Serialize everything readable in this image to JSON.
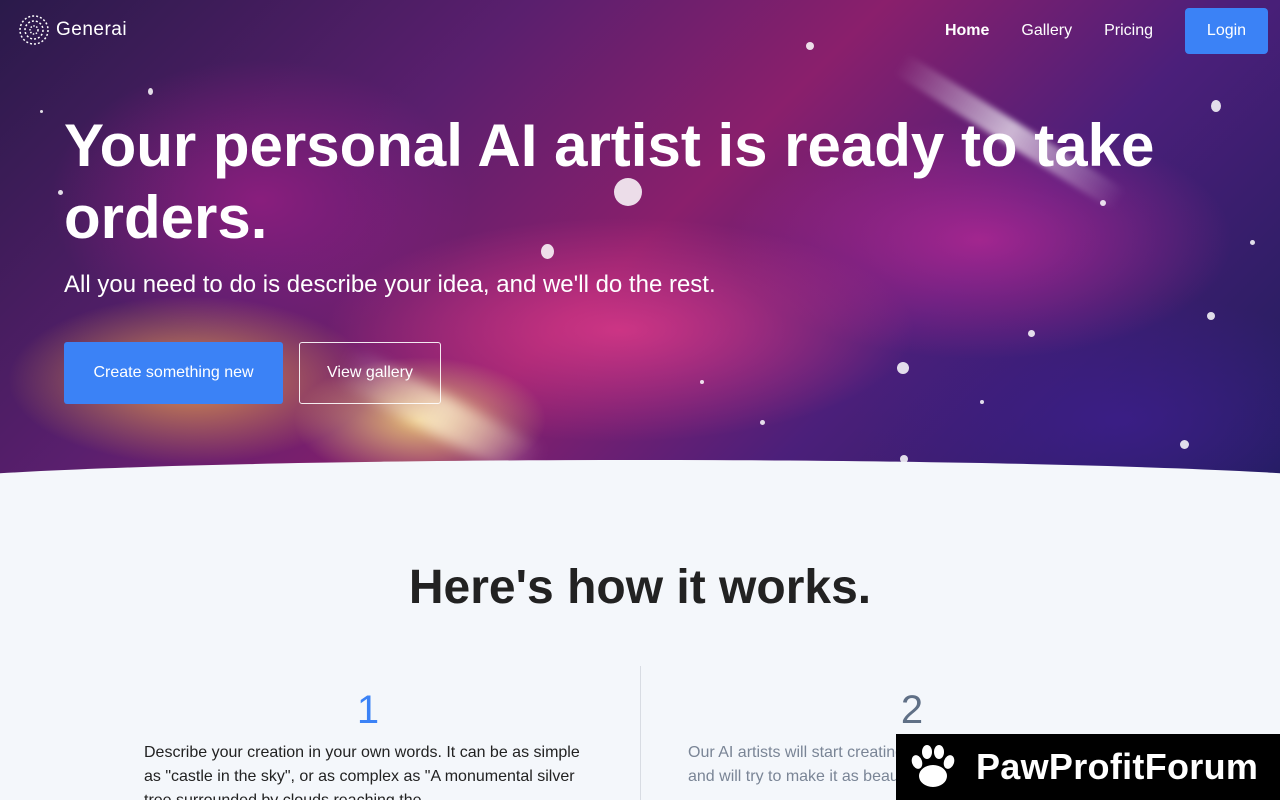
{
  "brand": {
    "name": "Generai"
  },
  "nav": {
    "items": [
      {
        "label": "Home",
        "active": true
      },
      {
        "label": "Gallery",
        "active": false
      },
      {
        "label": "Pricing",
        "active": false
      }
    ],
    "login_label": "Login"
  },
  "hero": {
    "title": "Your personal AI artist is ready to take orders.",
    "subtitle": "All you need to do is describe your idea, and we'll do the rest.",
    "primary_cta": "Create something new",
    "secondary_cta": "View gallery"
  },
  "how_it_works": {
    "title": "Here's how it works.",
    "steps": [
      {
        "number": "1",
        "text": "Describe your creation in your own words. It can be as simple as \"castle in the sky\", or as complex as \"A monumental silver tree surrounded by clouds reaching the"
      },
      {
        "number": "2",
        "text": "Our AI artists will start creating based on the text you provided and will try to make it as beautifully as possible."
      }
    ]
  },
  "watermark": {
    "text": "PawProfitForum"
  },
  "colors": {
    "accent": "#3b82f6",
    "page_bg": "#f4f7fb"
  }
}
